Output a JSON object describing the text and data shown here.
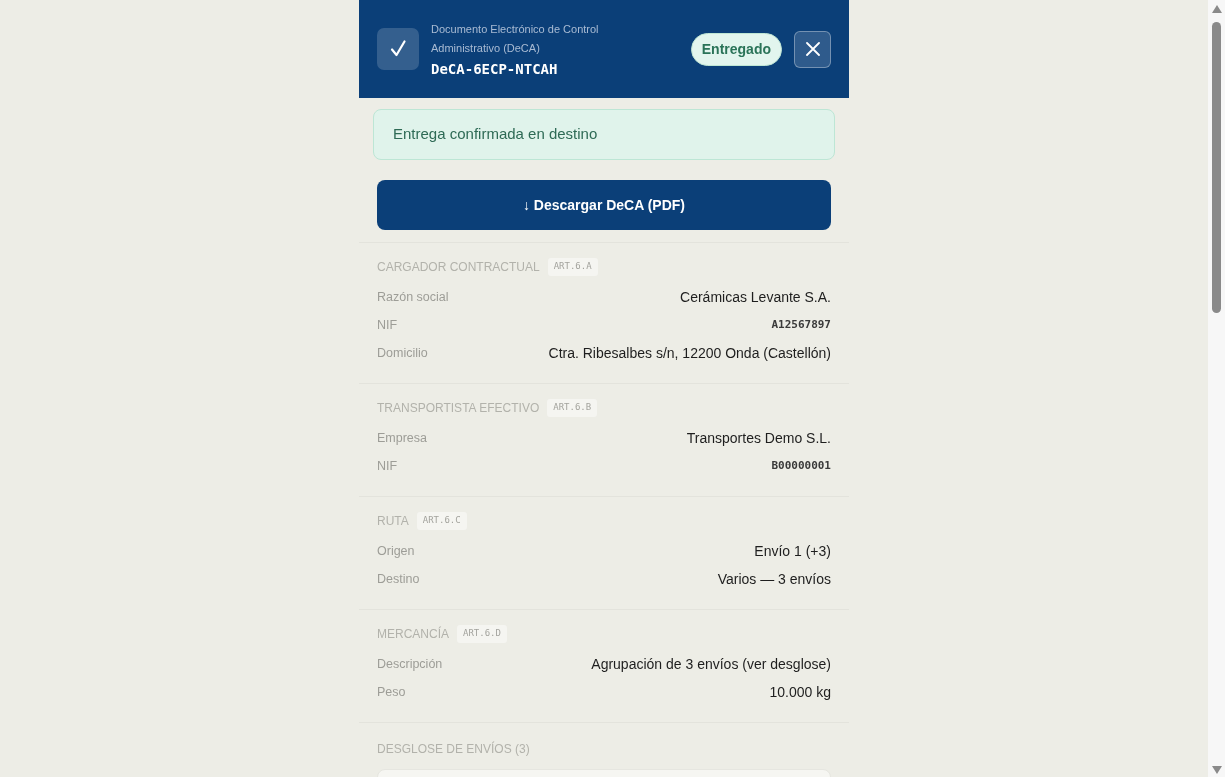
{
  "header": {
    "subtitle": "Documento Electrónico de Control Administrativo (DeCA)",
    "document_id": "DeCA-6ECP-NTCAH",
    "status_badge": "Entregado"
  },
  "alert": {
    "text": "Entrega confirmada en destino"
  },
  "download_button": {
    "label": "↓ Descargar DeCA (PDF)"
  },
  "sections": [
    {
      "title": "CARGADOR CONTRACTUAL",
      "article": "ART.6.A",
      "rows": [
        {
          "label": "Razón social",
          "value": "Cerámicas Levante S.A.",
          "kind": "text"
        },
        {
          "label": "NIF",
          "value": "A12567897",
          "kind": "code"
        },
        {
          "label": "Domicilio",
          "value": "Ctra. Ribesalbes s/n, 12200 Onda (Castellón)",
          "kind": "text"
        }
      ]
    },
    {
      "title": "TRANSPORTISTA EFECTIVO",
      "article": "ART.6.B",
      "rows": [
        {
          "label": "Empresa",
          "value": "Transportes Demo S.L.",
          "kind": "text"
        },
        {
          "label": "NIF",
          "value": "B00000001",
          "kind": "code"
        }
      ]
    },
    {
      "title": "RUTA",
      "article": "ART.6.C",
      "rows": [
        {
          "label": "Origen",
          "value": "Envío 1 (+3)",
          "kind": "text"
        },
        {
          "label": "Destino",
          "value": "Varios — 3 envíos",
          "kind": "text"
        }
      ]
    },
    {
      "title": "MERCANCÍA",
      "article": "ART.6.D",
      "rows": [
        {
          "label": "Descripción",
          "value": "Agrupación de 3 envíos (ver desglose)",
          "kind": "text"
        },
        {
          "label": "Peso",
          "value": "10.000 kg",
          "kind": "text"
        }
      ]
    }
  ],
  "breakdown": {
    "title": "DESGLOSE DE ENVÍOS (3)"
  }
}
